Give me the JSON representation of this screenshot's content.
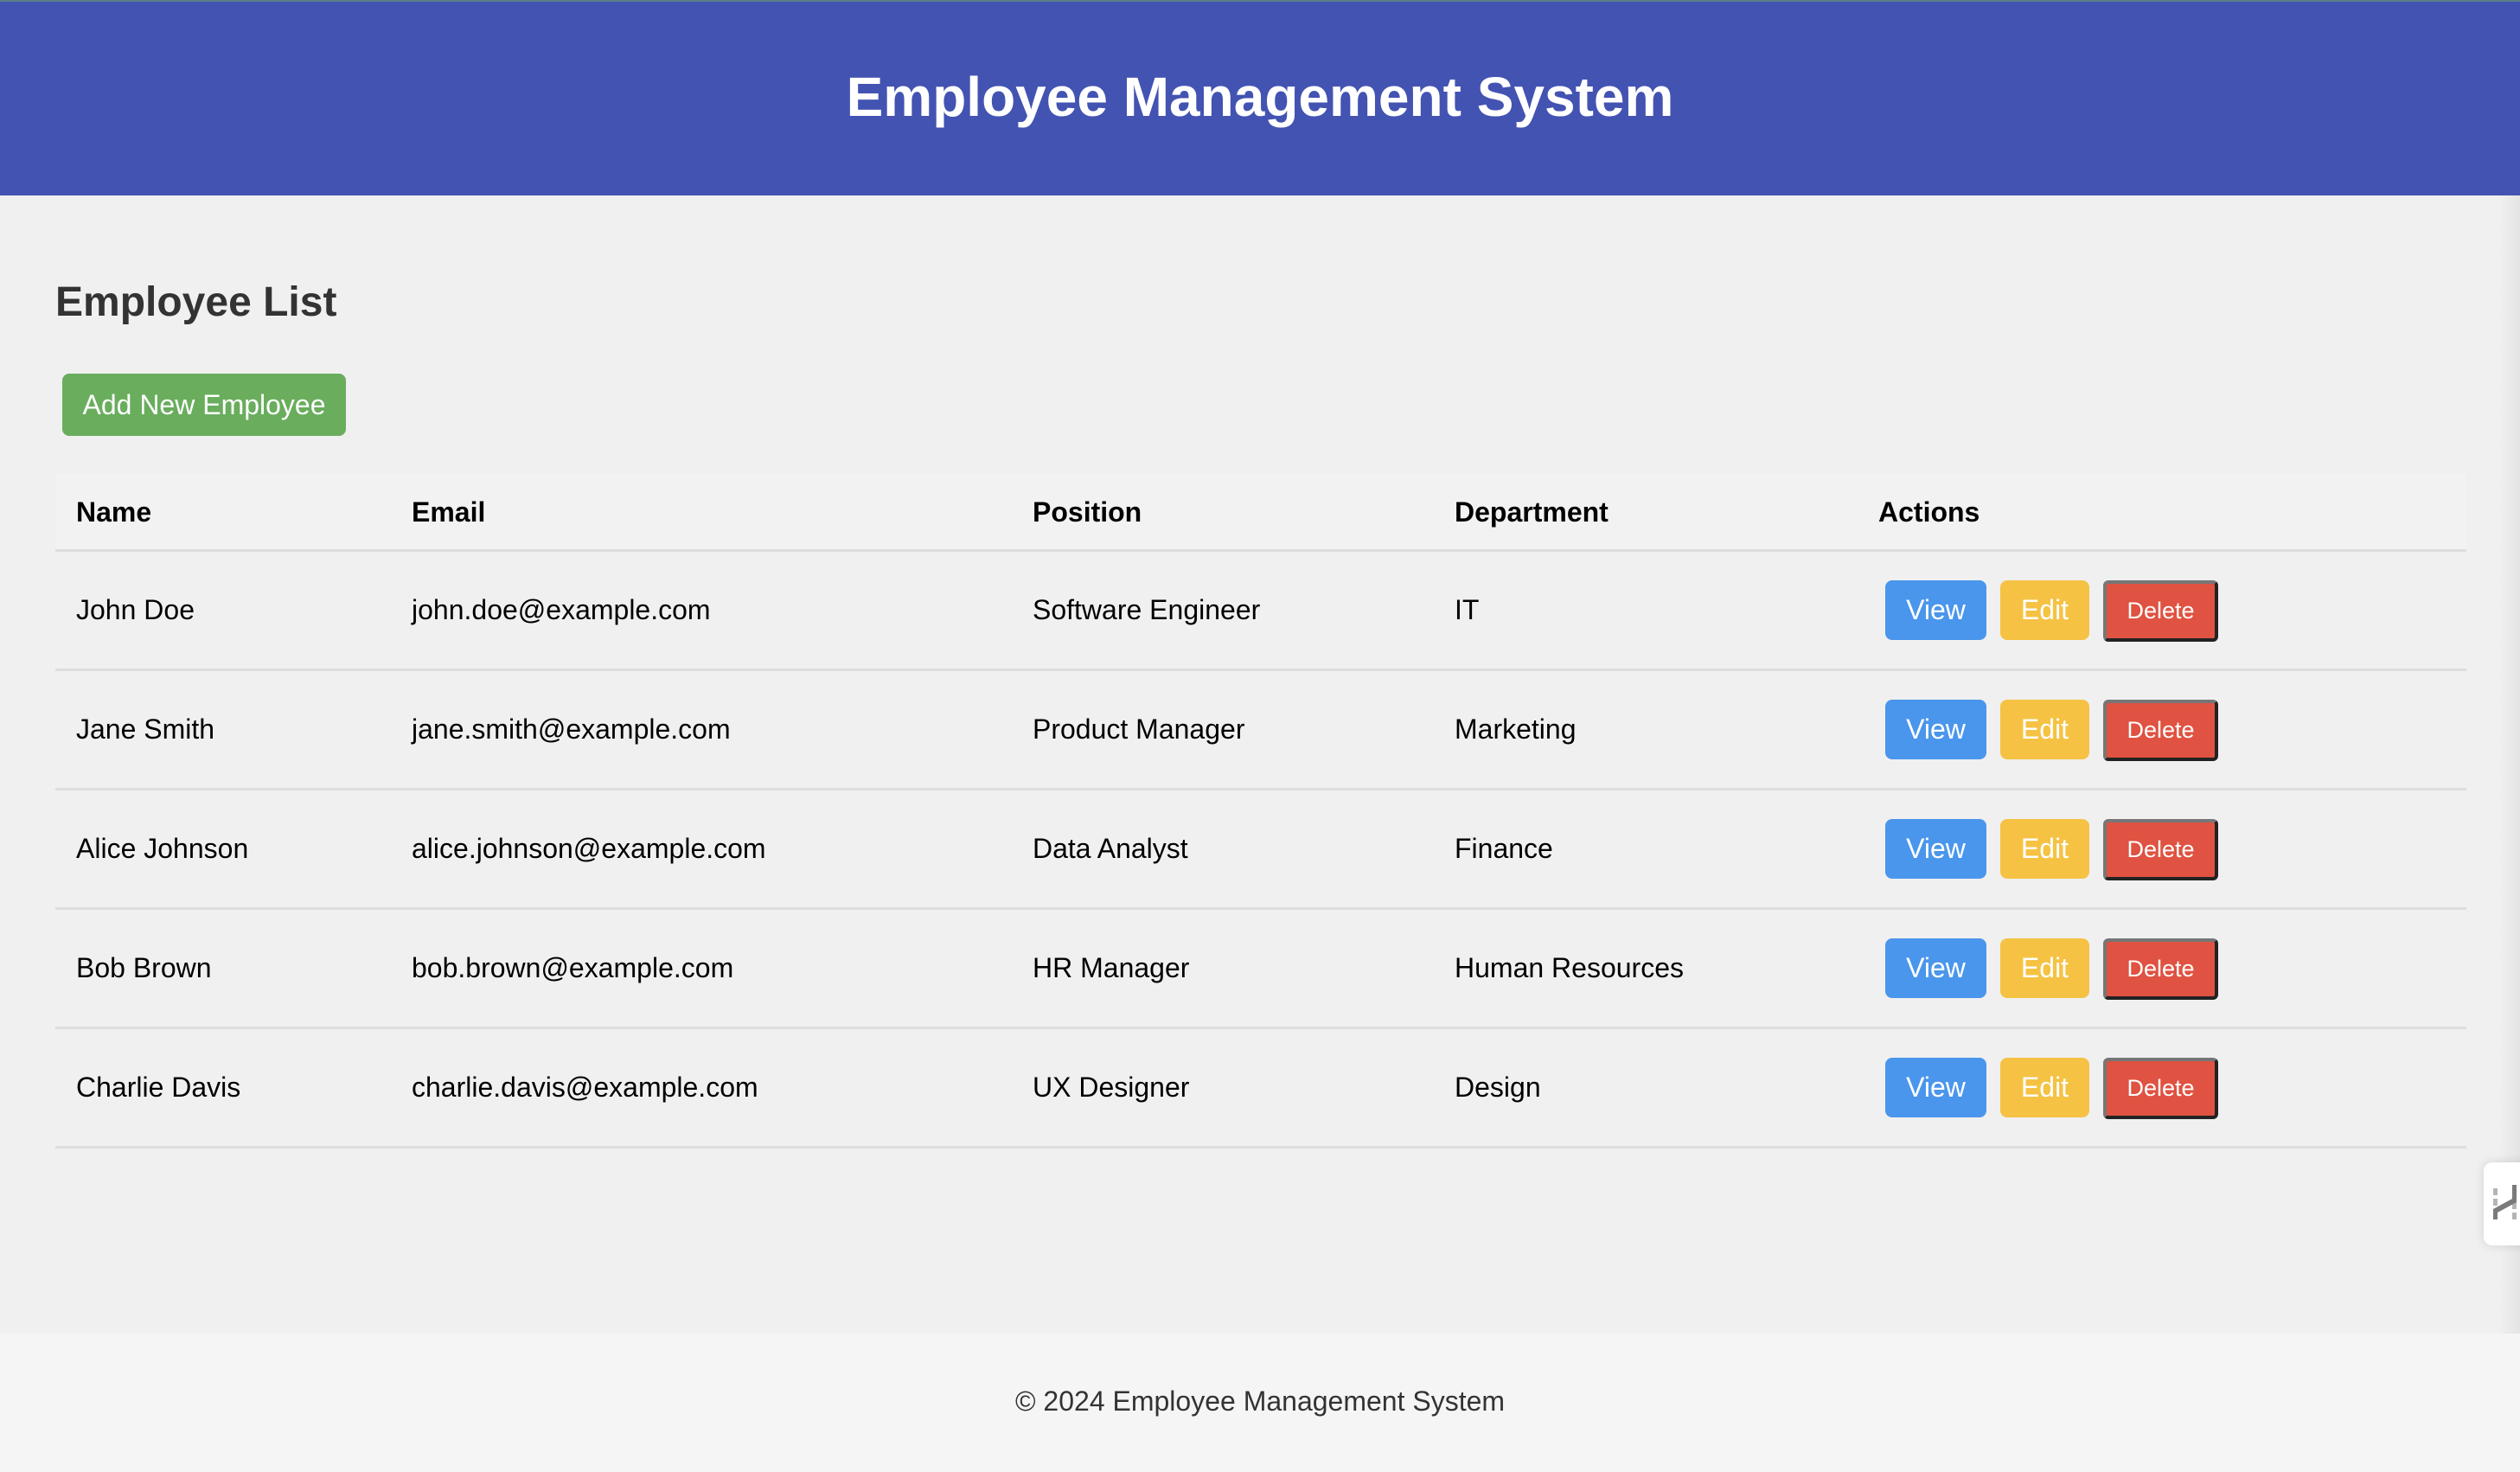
{
  "header": {
    "title": "Employee Management System",
    "background_color": "#4353b2"
  },
  "main": {
    "section_title": "Employee List",
    "add_button_label": "Add New Employee",
    "add_button_color": "#69ad5d"
  },
  "table": {
    "columns": [
      "Name",
      "Email",
      "Position",
      "Department",
      "Actions"
    ],
    "rows": [
      {
        "name": "John Doe",
        "email": "john.doe@example.com",
        "position": "Software Engineer",
        "department": "IT"
      },
      {
        "name": "Jane Smith",
        "email": "jane.smith@example.com",
        "position": "Product Manager",
        "department": "Marketing"
      },
      {
        "name": "Alice Johnson",
        "email": "alice.johnson@example.com",
        "position": "Data Analyst",
        "department": "Finance"
      },
      {
        "name": "Bob Brown",
        "email": "bob.brown@example.com",
        "position": "HR Manager",
        "department": "Human Resources"
      },
      {
        "name": "Charlie Davis",
        "email": "charlie.davis@example.com",
        "position": "UX Designer",
        "department": "Design"
      }
    ],
    "actions": {
      "view_label": "View",
      "edit_label": "Edit",
      "delete_label": "Delete",
      "view_color": "#4a96ec",
      "edit_color": "#f5c243",
      "delete_color": "#e05241"
    }
  },
  "footer": {
    "text": "© 2024 Employee Management System"
  },
  "side_widget": {
    "icon": "split-merge-icon"
  }
}
